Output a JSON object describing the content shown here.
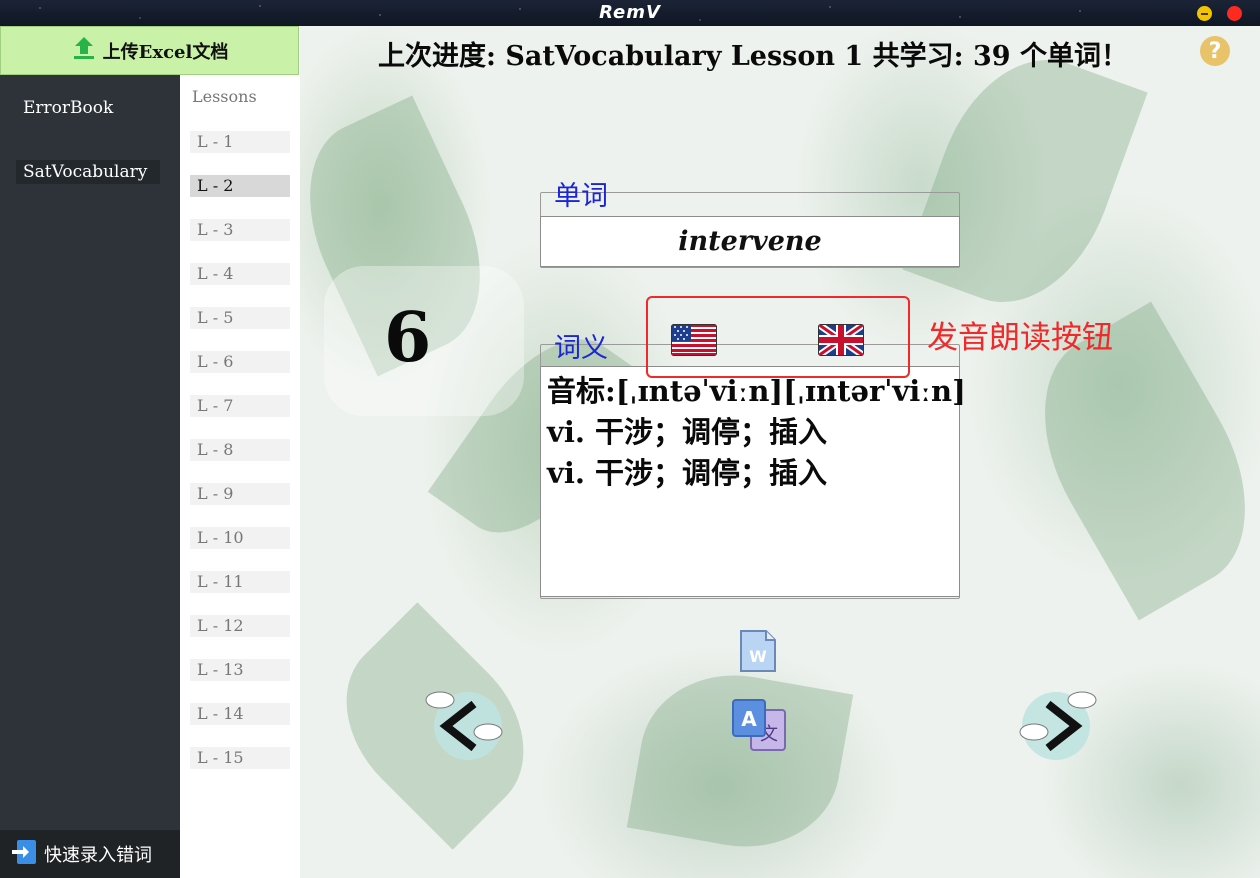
{
  "app": {
    "title": "RemV"
  },
  "sidebar": {
    "upload_label": "上传Excel文档",
    "items": [
      {
        "label": "ErrorBook",
        "active": false
      },
      {
        "label": "SatVocabulary",
        "active": true
      }
    ],
    "quick_entry_label": "快速录入错词"
  },
  "lessons": {
    "header": "Lessons",
    "items": [
      "L - 1",
      "L - 2",
      "L - 3",
      "L - 4",
      "L - 5",
      "L - 6",
      "L - 7",
      "L - 8",
      "L - 9",
      "L - 10",
      "L - 11",
      "L - 12",
      "L - 13",
      "L - 14",
      "L - 15"
    ],
    "active_index": 1
  },
  "main": {
    "progress_text": "上次进度: SatVocabulary Lesson 1  共学习: 39 个单词！",
    "counter": "6",
    "word_legend": "单词",
    "word": "intervene",
    "meaning_legend": "词义",
    "meaning_lines": [
      "音标:[ˌɪntəˈviːn][ˌɪntərˈviːn]",
      "vi. 干涉；调停；插入",
      "vi. 干涉；调停；插入"
    ],
    "annotation": "发音朗读按钮",
    "help_glyph": "?"
  },
  "icons": {
    "upload": "upload-icon",
    "quick_entry": "quick-entry-icon",
    "us_flag": "us-flag-icon",
    "uk_flag": "uk-flag-icon",
    "word_doc": "word-doc-icon",
    "translate": "translate-icon",
    "prev": "prev-arrow-icon",
    "next": "next-arrow-icon",
    "help": "help-icon"
  },
  "colors": {
    "accent_blue": "#1a25d8",
    "annotation_red": "#f02a2a",
    "upload_green": "#c9f2a8",
    "sidebar_dark": "#2d3338"
  }
}
